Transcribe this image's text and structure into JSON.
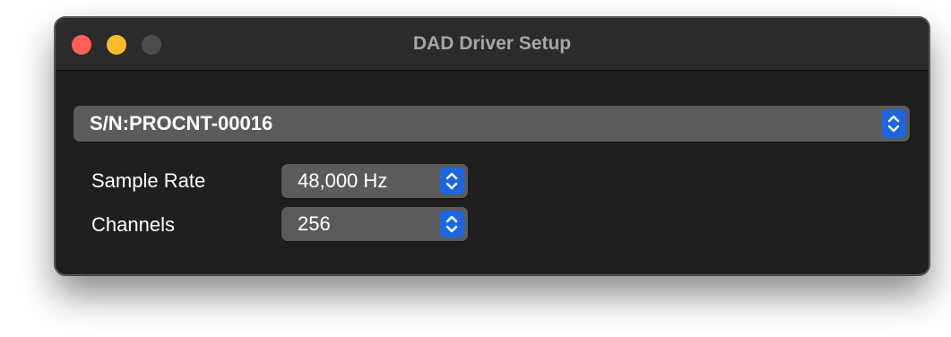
{
  "window": {
    "title": "DAD Driver Setup"
  },
  "device": {
    "selected": "S/N:PROCNT-00016"
  },
  "settings": {
    "sample_rate_label": "Sample Rate",
    "sample_rate_value": "48,000 Hz",
    "channels_label": "Channels",
    "channels_value": "256"
  },
  "colors": {
    "close": "#fe5f57",
    "minimize": "#febb2e",
    "zoom_disabled": "#4d4d4d",
    "accent": "#1e66e0",
    "window_bg": "#1f1f1f",
    "popup_bg": "#5b5b5b"
  },
  "icons": {
    "stepper": "chevron-up-down-icon"
  }
}
